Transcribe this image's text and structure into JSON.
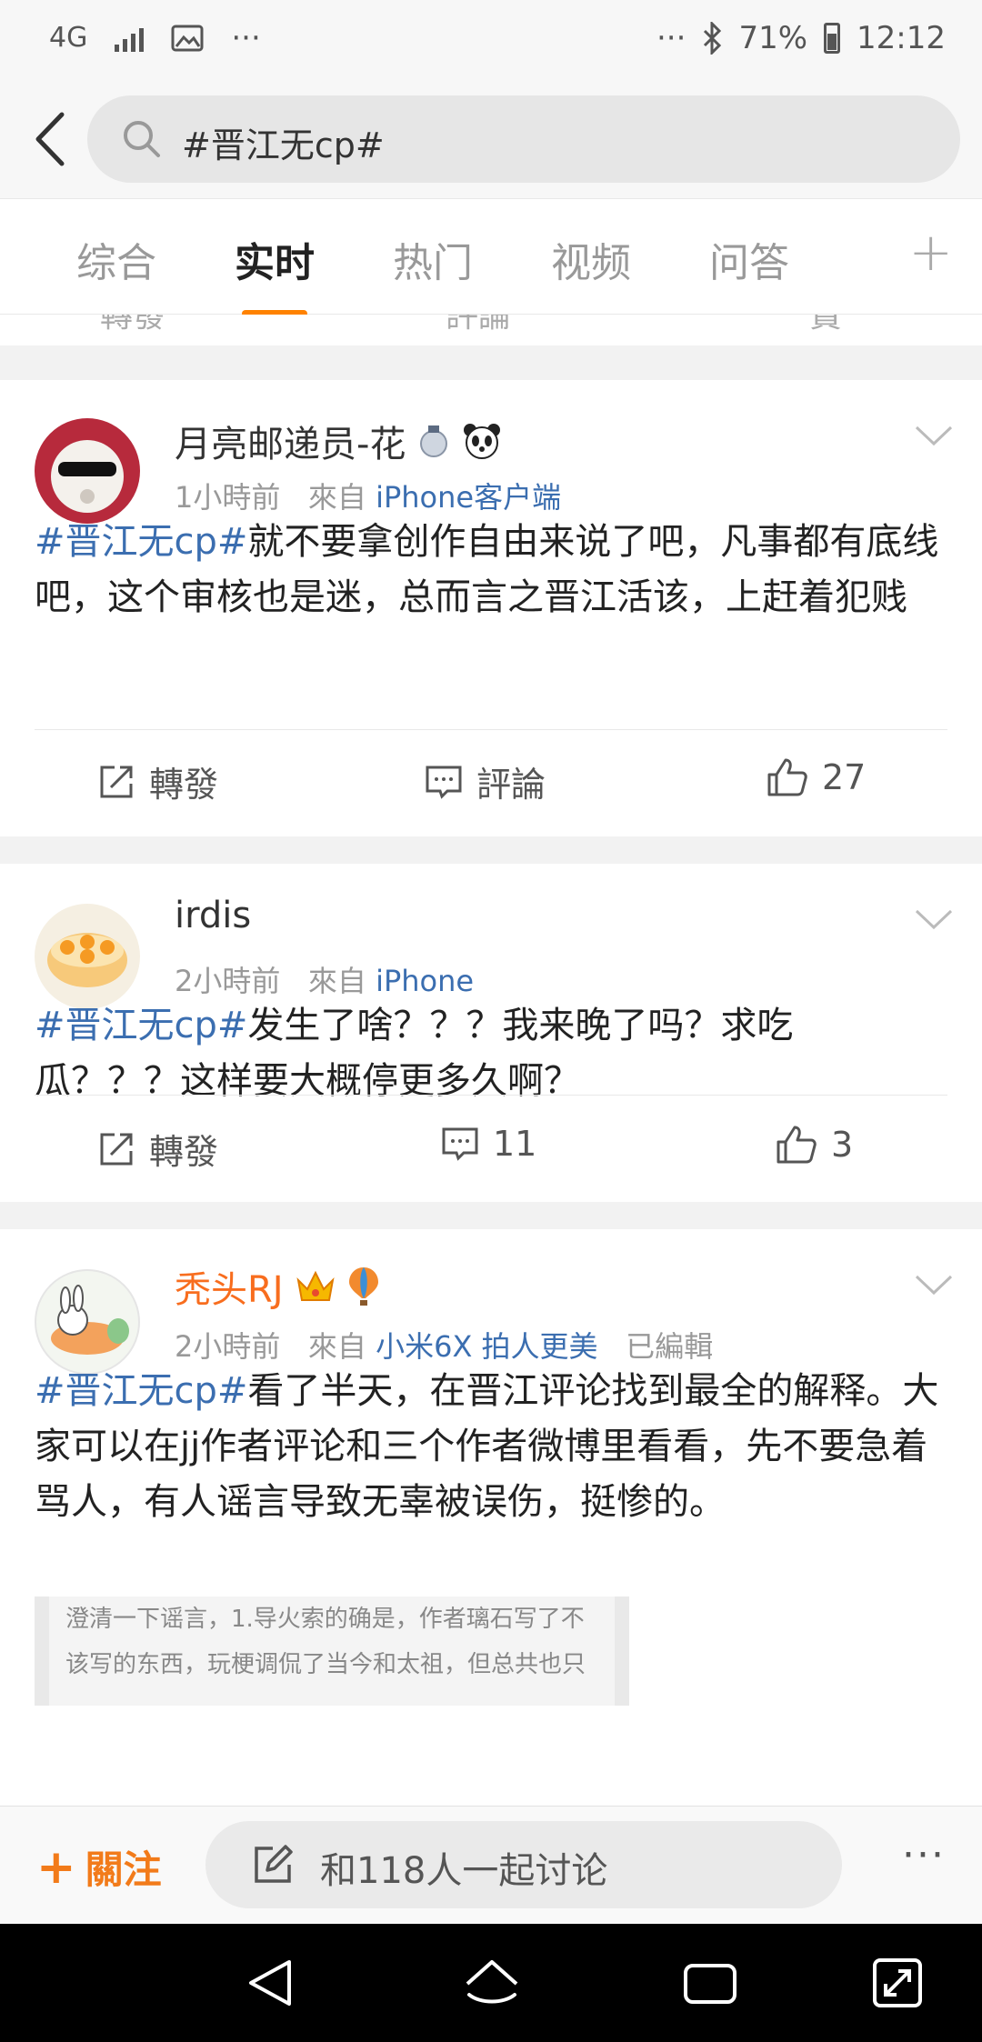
{
  "status": {
    "network": "4G",
    "dots": "···",
    "battery": "71%",
    "time": "12:12"
  },
  "search": {
    "query": "#晋江无cp#"
  },
  "tabs": [
    {
      "label": "综合"
    },
    {
      "label": "实时"
    },
    {
      "label": "热门"
    },
    {
      "label": "视频"
    },
    {
      "label": "问答"
    }
  ],
  "partial_actions": {
    "repost": "轉發",
    "comment": "評論",
    "like": "贊"
  },
  "posts": [
    {
      "user": "月亮邮递员-花",
      "time": "1小時前",
      "from_prefix": "來自",
      "source": "iPhone客户端",
      "hashtag": "#晋江无cp#",
      "body": "就不要拿创作自由来说了吧，凡事都有底线吧，这个审核也是迷，总而言之晋江活该，上赶着犯贱",
      "repost": "轉發",
      "comment": "評論",
      "likes": "27"
    },
    {
      "user": "irdis",
      "time": "2小時前",
      "from_prefix": "來自",
      "source": "iPhone",
      "hashtag": "#晋江无cp#",
      "body": "发生了啥？？？我来晚了吗？求吃瓜？？？这样要大概停更多久啊？",
      "repost": "轉發",
      "comment": "11",
      "likes": "3"
    },
    {
      "user": "秃头RJ",
      "time": "2小時前",
      "from_prefix": "來自",
      "source": "小米6X 拍人更美",
      "edited": "已編輯",
      "hashtag": "#晋江无cp#",
      "body": "看了半天，在晋江评论找到最全的解释。大家可以在jj作者评论和三个作者微博里看看，先不要急着骂人，有人谣言导致无辜被误伤，挺惨的。",
      "image_text_1": "澄清一下谣言，1.导火索的确是，作者璃石写了不",
      "image_text_2": "该写的东西，玩梗调侃了当今和太祖，但总共也只"
    }
  ],
  "bottom": {
    "follow": "關注",
    "discuss": "和118人一起讨论",
    "more": "···"
  },
  "colors": {
    "accent": "#ff8200",
    "link": "#3b6eb0",
    "username_vip": "#f86d1e"
  }
}
